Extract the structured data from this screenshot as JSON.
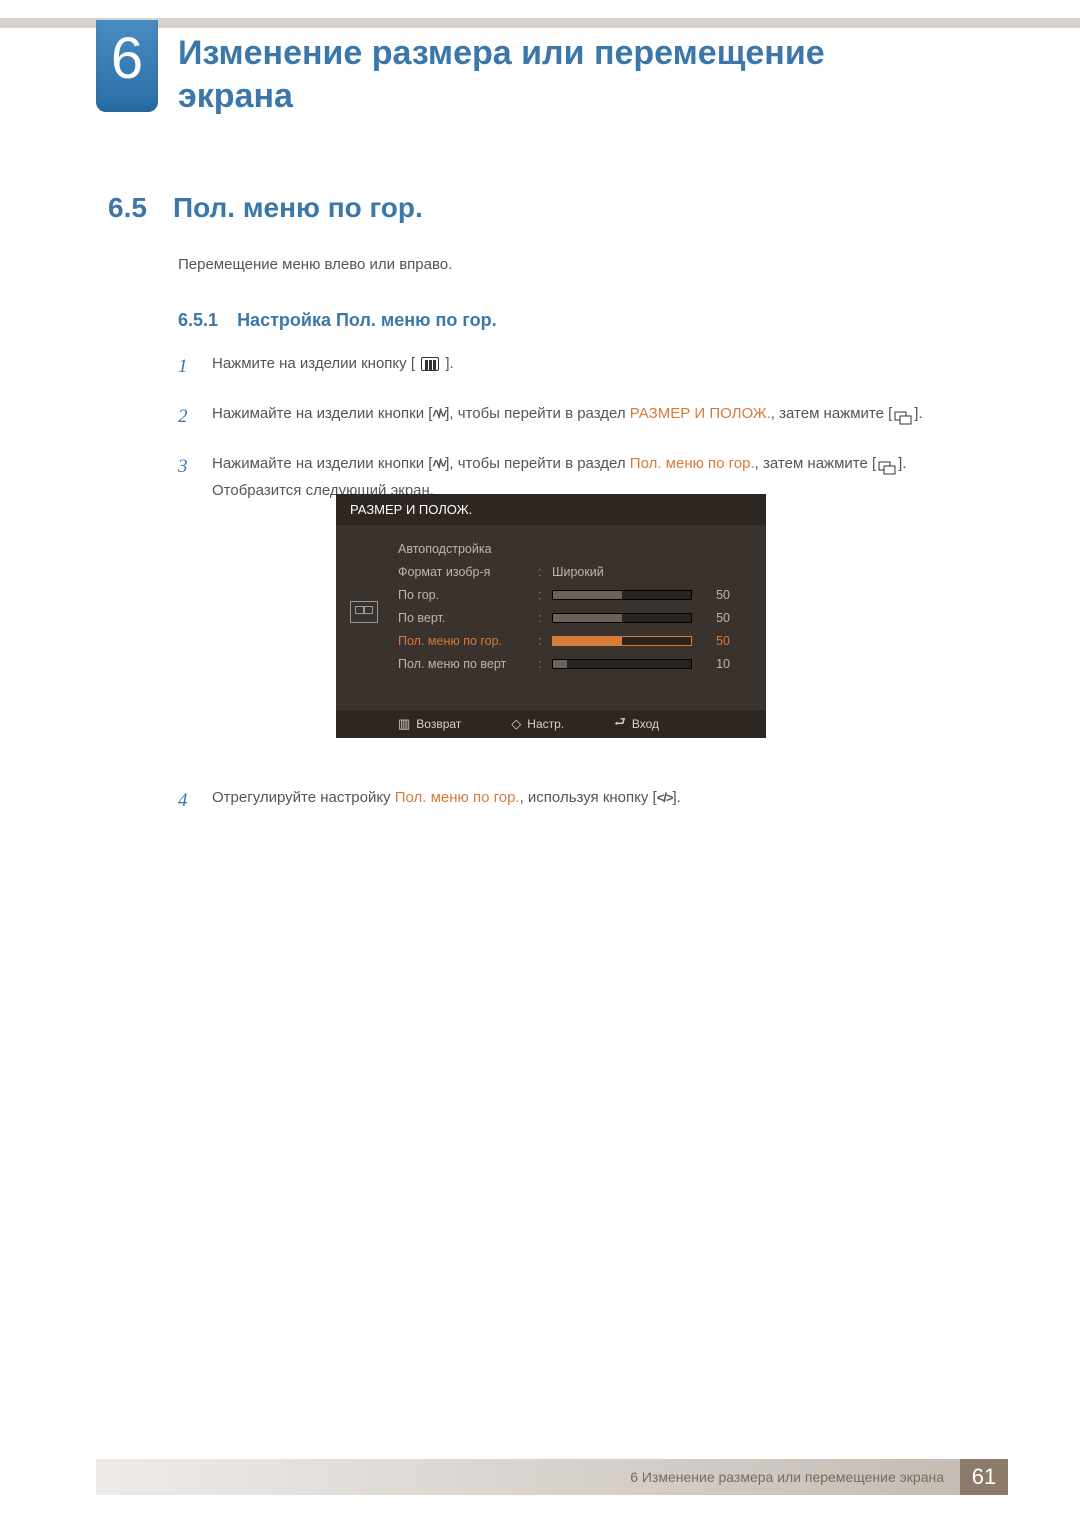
{
  "chapter": {
    "number": "6",
    "title": "Изменение размера или перемещение экрана"
  },
  "section": {
    "number": "6.5",
    "title": "Пол. меню по гор."
  },
  "intro": "Перемещение меню влево или вправо.",
  "subsection": {
    "number": "6.5.1",
    "title": "Настройка Пол. меню по гор."
  },
  "steps": {
    "s1": {
      "n": "1",
      "pre": "Нажмите на изделии кнопку [",
      "post": " ]."
    },
    "s2": {
      "n": "2",
      "pre": "Нажимайте на изделии кнопки [",
      "mid1": "], чтобы перейти в раздел ",
      "hl": "РАЗМЕР И ПОЛОЖ.",
      "mid2": ", затем нажмите [",
      "post": "]."
    },
    "s3": {
      "n": "3",
      "pre": "Нажимайте на изделии кнопки [",
      "mid1": "], чтобы перейти в раздел ",
      "hl": "Пол. меню по гор.",
      "mid2": ", затем нажмите [",
      "post": "]. Отобразится следующий экран."
    },
    "s4": {
      "n": "4",
      "pre": "Отрегулируйте настройку ",
      "hl": "Пол. меню по гор.",
      "mid": ", используя кнопку [",
      "post": "]."
    }
  },
  "osd": {
    "header": "РАЗМЕР И ПОЛОЖ.",
    "rows": [
      {
        "label": "Автоподстройка",
        "type": "none"
      },
      {
        "label": "Формат изобр-я",
        "type": "text",
        "value": "Широкий"
      },
      {
        "label": "По гор.",
        "type": "slider",
        "value": "50",
        "pct": 50
      },
      {
        "label": "По верт.",
        "type": "slider",
        "value": "50",
        "pct": 50
      },
      {
        "label": "Пол. меню по гор.",
        "type": "slider",
        "value": "50",
        "pct": 50,
        "active": true
      },
      {
        "label": "Пол. меню по верт",
        "type": "slider",
        "value": "10",
        "pct": 10
      }
    ],
    "footer": {
      "back": "Возврат",
      "adjust": "Настр.",
      "enter": "Вход"
    }
  },
  "footer": {
    "text": "6 Изменение размера или перемещение экрана",
    "page": "61"
  }
}
